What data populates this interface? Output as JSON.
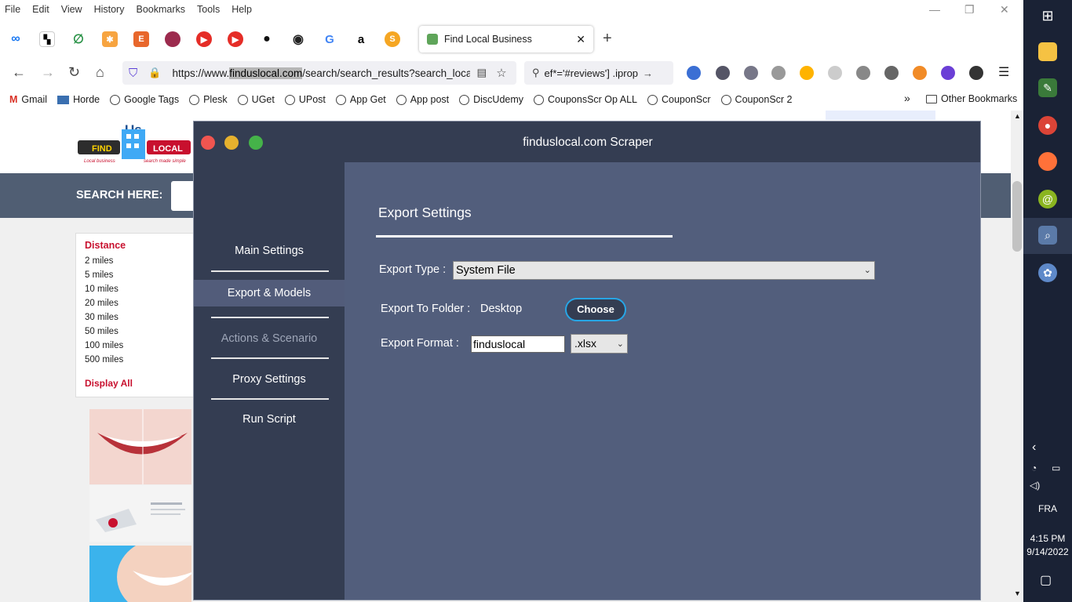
{
  "menubar": [
    "File",
    "Edit",
    "View",
    "History",
    "Bookmarks",
    "Tools",
    "Help"
  ],
  "tab": {
    "title": "Find Local Business"
  },
  "url": {
    "prefix": "https://www.",
    "domain": "finduslocal.com",
    "rest": "/search/search_results?search_loca"
  },
  "findbar": {
    "text": "ef*='#reviews'] .iprop"
  },
  "bookmarks": [
    "Gmail",
    "Horde",
    "Google Tags",
    "Plesk",
    "UGet",
    "UPost",
    "App Get",
    "App post",
    "DiscUdemy",
    "CouponsScr Op ALL",
    "CouponScr",
    "CouponScr 2"
  ],
  "other_bookmarks": "Other Bookmarks",
  "site": {
    "search_label": "SEARCH HERE:",
    "distance_heading": "Distance",
    "distances": [
      "2 miles",
      "5 miles",
      "10 miles",
      "20 miles",
      "30 miles",
      "50 miles",
      "100 miles",
      "500 miles"
    ],
    "display_all": "Display All",
    "logo": {
      "us": "Us",
      "find": "FIND",
      "local": "LOCAL",
      "tagline_left": "Local business",
      "tagline_right": "search made simple"
    }
  },
  "app": {
    "title": "finduslocal.com Scraper",
    "sidebar": {
      "main_settings": "Main Settings",
      "export_models": "Export & Models",
      "actions_scenario": "Actions & Scenario",
      "proxy_settings": "Proxy Settings",
      "run_script": "Run Script"
    },
    "section_title": "Export Settings",
    "export_type_label": "Export Type :",
    "export_type_value": "System File",
    "export_folder_label": "Export To Folder :",
    "export_folder_value": "Desktop",
    "choose_button": "Choose",
    "export_format_label": "Export Format :",
    "export_format_name": "finduslocal",
    "export_format_ext": ".xlsx"
  },
  "taskbar": {
    "language": "FRA",
    "time": "4:15 PM",
    "date": "9/14/2022"
  },
  "colors": {
    "app_bg": "#343d52",
    "panel_bg": "#525e7c",
    "accent": "#27a6e6",
    "site_red": "#c8102e"
  }
}
